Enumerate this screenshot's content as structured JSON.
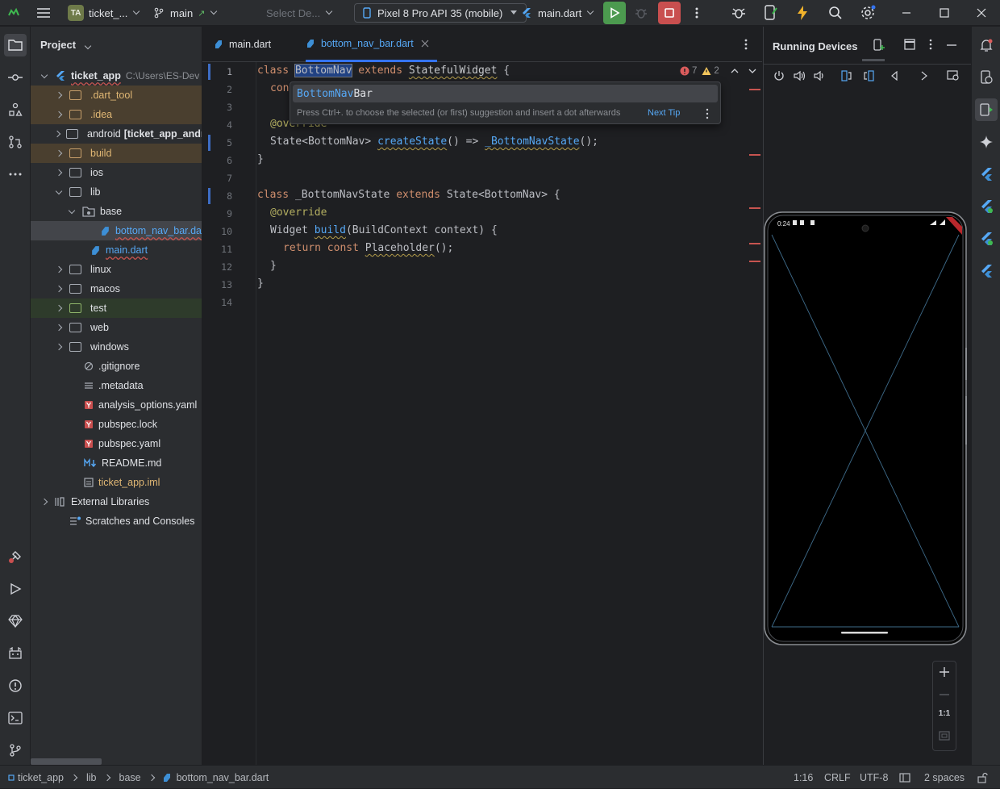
{
  "titlebar": {
    "project_badge": "TA",
    "project_name": "ticket_...",
    "branch": "main",
    "select_device": "Select De...",
    "device": "Pixel 8 Pro API 35 (mobile)",
    "run_config": "main.dart",
    "accent_run": "#4c9a4f",
    "accent_stop": "#c94f4f"
  },
  "project_panel": {
    "title": "Project",
    "root_name": "ticket_app",
    "root_path": "C:\\Users\\ES-Dev",
    "items": [
      {
        "label": "ticket_app",
        "kind": "root"
      },
      {
        "label": ".dart_tool",
        "kind": "folder-excluded"
      },
      {
        "label": ".idea",
        "kind": "folder-excluded"
      },
      {
        "label": "android",
        "suffix": "[ticket_app_andr",
        "kind": "folder"
      },
      {
        "label": "build",
        "kind": "folder-excluded"
      },
      {
        "label": "ios",
        "kind": "folder"
      },
      {
        "label": "lib",
        "kind": "folder-open"
      },
      {
        "label": "base",
        "kind": "package-open"
      },
      {
        "label": "bottom_nav_bar.da",
        "kind": "dart-selected"
      },
      {
        "label": "main.dart",
        "kind": "dart"
      },
      {
        "label": "linux",
        "kind": "folder"
      },
      {
        "label": "macos",
        "kind": "folder"
      },
      {
        "label": "test",
        "kind": "folder-test"
      },
      {
        "label": "web",
        "kind": "folder"
      },
      {
        "label": "windows",
        "kind": "folder"
      },
      {
        "label": ".gitignore",
        "kind": "file"
      },
      {
        "label": ".metadata",
        "kind": "file"
      },
      {
        "label": "analysis_options.yaml",
        "kind": "yaml"
      },
      {
        "label": "pubspec.lock",
        "kind": "yaml"
      },
      {
        "label": "pubspec.yaml",
        "kind": "yaml"
      },
      {
        "label": "README.md",
        "kind": "md"
      },
      {
        "label": "ticket_app.iml",
        "kind": "iml"
      },
      {
        "label": "External Libraries",
        "kind": "lib"
      },
      {
        "label": "Scratches and Consoles",
        "kind": "scratch"
      }
    ]
  },
  "editor": {
    "tabs": [
      {
        "label": "main.dart",
        "active": false
      },
      {
        "label": "bottom_nav_bar.dart",
        "active": true
      }
    ],
    "inspection": {
      "errors": "7",
      "warnings": "2"
    },
    "line_numbers": [
      "1",
      "2",
      "3",
      "4",
      "5",
      "6",
      "7",
      "8",
      "9",
      "10",
      "11",
      "12",
      "13",
      "14"
    ],
    "lines": {
      "l1": {
        "kw": "class",
        "name": "BottomNav",
        "kw2": "extends",
        "type": "StatefulWidget",
        "tail": " {"
      },
      "l2": {
        "text": "con"
      },
      "l4": {
        "text": "@override"
      },
      "l5": {
        "a": "State<BottomNav> ",
        "fn": "createState",
        "b": "() => ",
        "c": "_BottomNavState",
        "d": "();"
      },
      "l6": {
        "text": "}"
      },
      "l8": {
        "kw": "class",
        "name": " _BottomNavState ",
        "kw2": "extends",
        "type": " State<BottomNav> {"
      },
      "l9": {
        "text": "@override"
      },
      "l10": {
        "a": "Widget ",
        "fn": "build",
        "b": "(BuildContext context) {"
      },
      "l11": {
        "kw": "return const ",
        "c": "Placeholder",
        "d": "();"
      },
      "l12": {
        "text": "}"
      },
      "l13": {
        "text": "}"
      }
    },
    "completion": {
      "match": "BottomNav",
      "rest": "Bar",
      "hint": "Press Ctrl+. to choose the selected (or first) suggestion and insert a dot afterwards",
      "next_tip": "Next Tip"
    }
  },
  "running_devices": {
    "title": "Running Devices",
    "phone_time": "0:24",
    "zoom_ratio": "1:1"
  },
  "status_bar": {
    "breadcrumb": [
      "ticket_app",
      "lib",
      "base",
      "bottom_nav_bar.dart"
    ],
    "position": "1:16",
    "line_sep": "CRLF",
    "encoding": "UTF-8",
    "indent": "2 spaces"
  }
}
